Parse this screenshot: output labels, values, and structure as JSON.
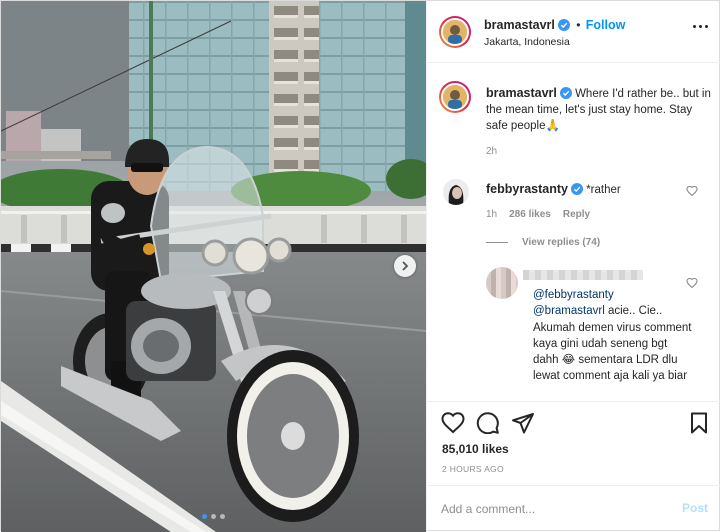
{
  "post": {
    "author": "bramastavrl",
    "follow_label": "Follow",
    "location": "Jakarta, Indonesia",
    "follow_separator": "•"
  },
  "caption": {
    "username": "bramastavrl",
    "text": "Where I'd rather be.. but in the mean time, let's just stay home. Stay safe people🙏",
    "time": "2h"
  },
  "comment": {
    "username": "febbyrastanty",
    "text": "*rather",
    "time": "1h",
    "likes": "286 likes",
    "reply_label": "Reply",
    "view_replies": "View replies (74)"
  },
  "reply": {
    "mention1": "@febbyrastanty",
    "mention2": "@bramastavrl",
    "text": "acie.. Cie.. Akumah demen virus comment kaya gini udah seneng bgt dahh 😂 sementara LDR dlu lewat comment aja kali ya biar"
  },
  "stats": {
    "likes": "85,010 likes",
    "time_ago": "2 HOURS AGO"
  },
  "composer": {
    "placeholder": "Add a comment...",
    "post_label": "Post"
  },
  "colors": {
    "accent": "#0095f6",
    "verified": "#3897f0",
    "muted": "#8e8e8e"
  },
  "carousel": {
    "total": 3,
    "active": 1
  }
}
